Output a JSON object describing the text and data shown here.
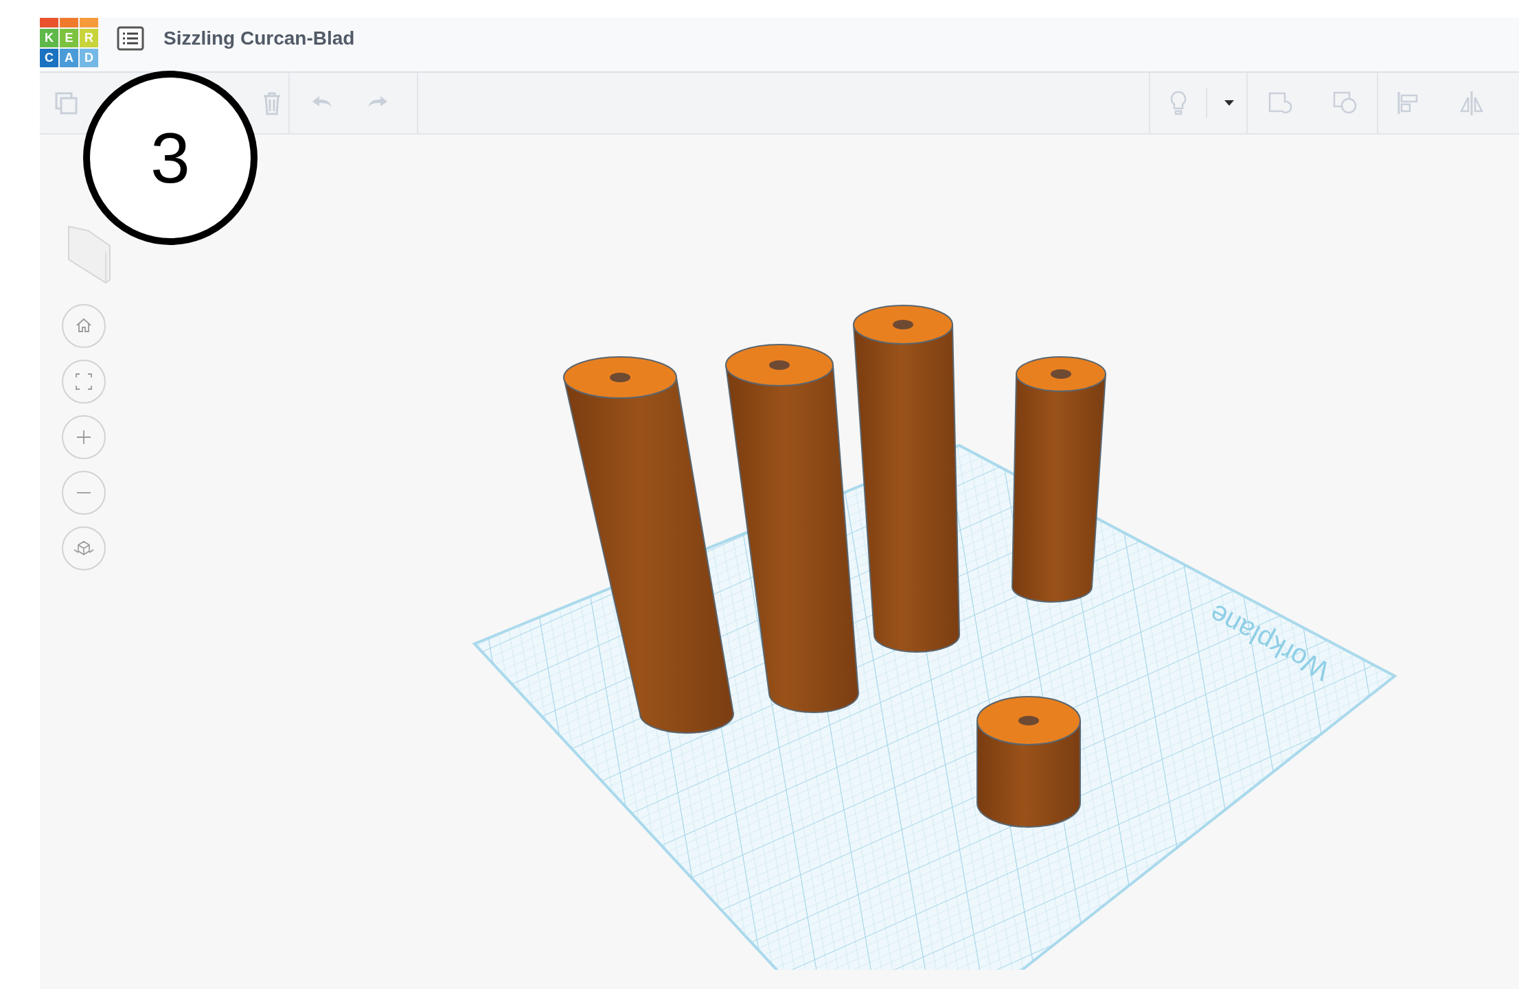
{
  "header": {
    "logo_rows": [
      [
        "K",
        "E",
        "R"
      ],
      [
        "C",
        "A",
        "D"
      ]
    ],
    "title": "Sizzling Curcan-Blad"
  },
  "toolbar": {
    "left_groups": [
      [
        {
          "kind": "copy",
          "disabled": true
        },
        {
          "kind": "trash",
          "disabled": true
        }
      ],
      [
        {
          "kind": "undo",
          "disabled": true
        },
        {
          "kind": "redo",
          "disabled": true
        }
      ]
    ],
    "right_groups": [
      [
        {
          "kind": "light",
          "disabled": true
        },
        {
          "kind": "dropdown",
          "disabled": false
        }
      ],
      [
        {
          "kind": "group",
          "disabled": true
        },
        {
          "kind": "ungroup",
          "disabled": true
        }
      ],
      [
        {
          "kind": "align",
          "disabled": true
        },
        {
          "kind": "mirror",
          "disabled": true
        }
      ]
    ]
  },
  "view_controls": [
    {
      "kind": "home"
    },
    {
      "kind": "fit"
    },
    {
      "kind": "zoom-in"
    },
    {
      "kind": "zoom-out"
    },
    {
      "kind": "ortho"
    }
  ],
  "workplane": {
    "label": "Workplane"
  },
  "objects": [
    {
      "kind": "cylinder"
    },
    {
      "kind": "cylinder"
    },
    {
      "kind": "cylinder"
    },
    {
      "kind": "cylinder"
    },
    {
      "kind": "cylinder"
    }
  ],
  "annotation": {
    "label": "3"
  }
}
